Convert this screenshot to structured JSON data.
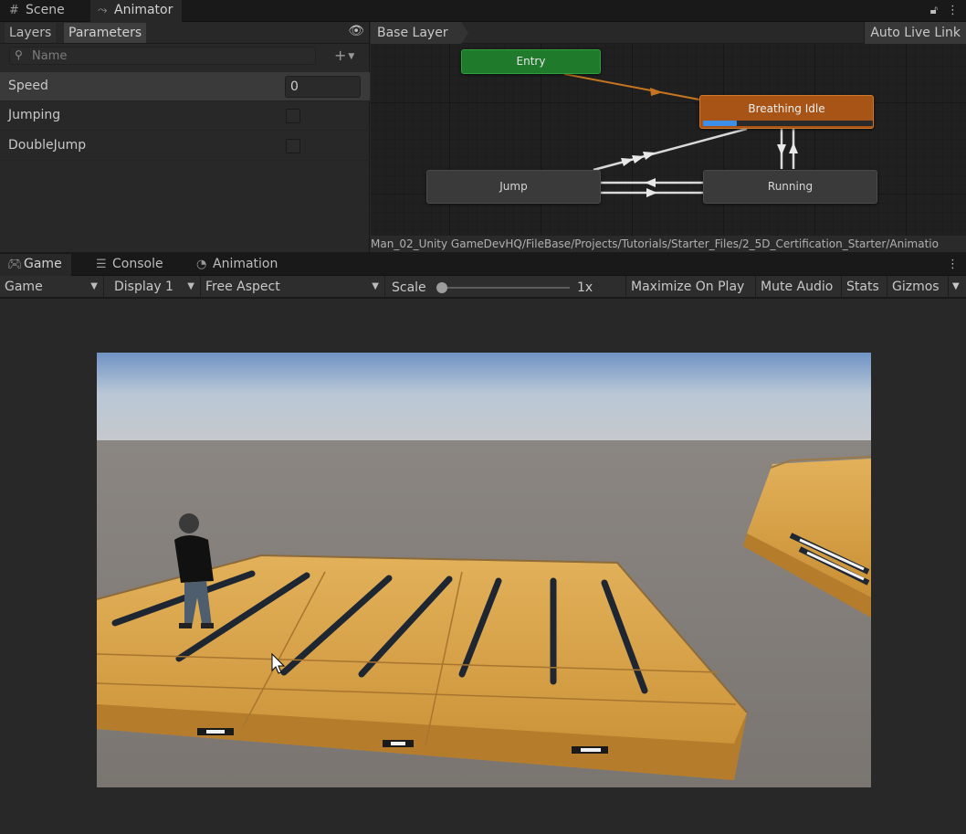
{
  "animator_tabs": [
    {
      "label": "Scene",
      "icon": "grid-icon"
    },
    {
      "label": "Animator",
      "icon": "animator-icon"
    }
  ],
  "animator": {
    "subtabs": [
      "Layers",
      "Parameters"
    ],
    "search_placeholder": "Name",
    "parameters": [
      {
        "name": "Speed",
        "type": "float",
        "value": "0"
      },
      {
        "name": "Jumping",
        "type": "bool",
        "value": false
      },
      {
        "name": "DoubleJump",
        "type": "bool",
        "value": false
      }
    ],
    "breadcrumb": "Base Layer",
    "auto_live_link": "Auto Live Link",
    "states": {
      "entry": "Entry",
      "default": "Breathing Idle",
      "jump": "Jump",
      "running": "Running"
    },
    "default_state_progress": 0.2,
    "asset_path": "Man_02_Unity GameDevHQ/FileBase/Projects/Tutorials/Starter_Files/2_5D_Certification_Starter/Animatio"
  },
  "game_tabs": [
    {
      "label": "Game",
      "icon": "gamepad-icon"
    },
    {
      "label": "Console",
      "icon": "console-icon"
    },
    {
      "label": "Animation",
      "icon": "clock-icon"
    }
  ],
  "game_toolbar": {
    "display_mode": "Game",
    "display": "Display 1",
    "aspect": "Free Aspect",
    "scale_label": "Scale",
    "scale_value": "1x",
    "scale_slider": 0.0,
    "maximize_on_play": "Maximize On Play",
    "mute_audio": "Mute Audio",
    "stats": "Stats",
    "gizmos": "Gizmos"
  },
  "colors": {
    "entry_state": "#1f7a2c",
    "default_state": "#a95417",
    "progress": "#3c8ee6",
    "platform": "#d9a444"
  }
}
